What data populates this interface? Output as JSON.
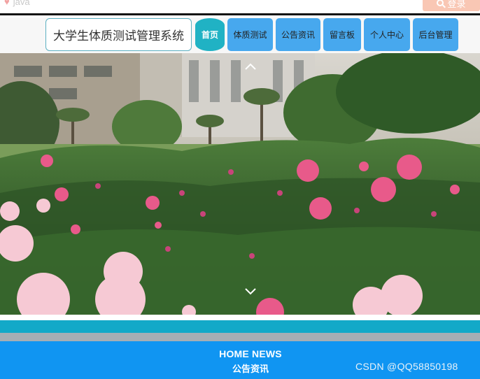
{
  "topbar": {
    "search_hint": "java",
    "login_label": "登录"
  },
  "header": {
    "site_title": "大学生体质测试管理系统",
    "nav": [
      {
        "label": "首页",
        "active": true
      },
      {
        "label": "体质测试",
        "active": false
      },
      {
        "label": "公告资讯",
        "active": false
      },
      {
        "label": "留言板",
        "active": false
      },
      {
        "label": "个人中心",
        "active": false
      },
      {
        "label": "后台管理",
        "active": false
      }
    ]
  },
  "carousel": {
    "prev_icon": "chevron-up-icon",
    "next_icon": "chevron-down-icon"
  },
  "news": {
    "heading_en": "HOME NEWS",
    "heading_cn": "公告资讯"
  },
  "watermark": "CSDN @QQ58850198",
  "colors": {
    "nav_blue": "#47a8ee",
    "nav_active": "#20b2c4",
    "title_border": "#5cb0c2",
    "footer_blue": "#1095f2",
    "teal_stripe": "#13a9c8"
  }
}
